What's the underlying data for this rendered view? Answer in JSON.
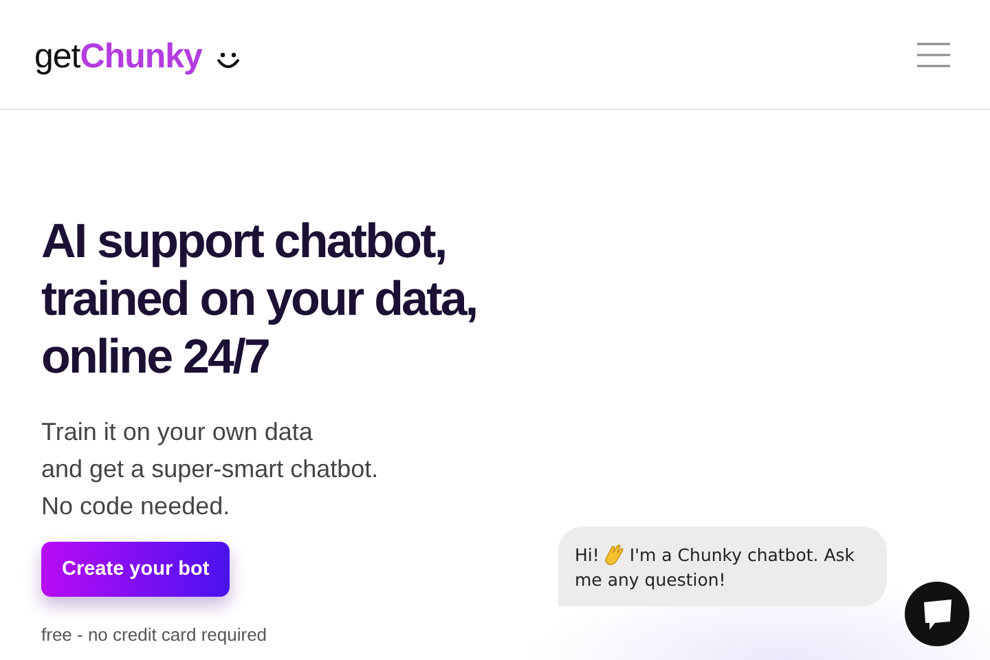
{
  "header": {
    "logo_prefix": "get",
    "logo_brand": "Chunky"
  },
  "hero": {
    "headline_lines": [
      "AI support chatbot,",
      "trained on your data,",
      "online 24/7"
    ],
    "subtitle_lines": [
      "Train it on your own data",
      "and get a super-smart chatbot.",
      "No code needed."
    ],
    "cta": "Create your bot",
    "note": "free - no credit card required"
  },
  "chat": {
    "greeting": "Hi!",
    "message_lines": [
      "I'm a Chunky chatbot. Ask",
      "me any question!"
    ]
  }
}
